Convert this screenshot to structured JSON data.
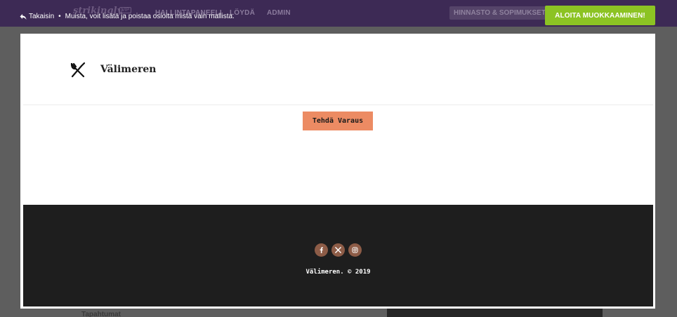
{
  "background": {
    "logo": "strikingly",
    "logo_badge": "VIP",
    "nav": [
      "HALLINTAPANEELI",
      "LÖYDÄ",
      "ADMIN"
    ],
    "pricing": "HINNASTO & SOPIMUKSET",
    "sidebar_fragment": "Tapahtumat"
  },
  "top_bar": {
    "back_label": "Takaisin",
    "hint": "Muista, voit lisätä ja poistaa osioita mistä vain mallista.",
    "start_label": "ALOITA MUOKKAAMINEN!",
    "start_color": "#8cc323"
  },
  "preview": {
    "header": {
      "logo_icon": "fork-knife-icon",
      "title": "Välimeren"
    },
    "cta_label": "Tehdä Varaus",
    "cta_color": "#ec8b63",
    "footer": {
      "socials": [
        "facebook-icon",
        "x-icon",
        "instagram-icon"
      ],
      "social_color": "#8d5c47",
      "copyright": "Välimeren. © 2019"
    }
  }
}
